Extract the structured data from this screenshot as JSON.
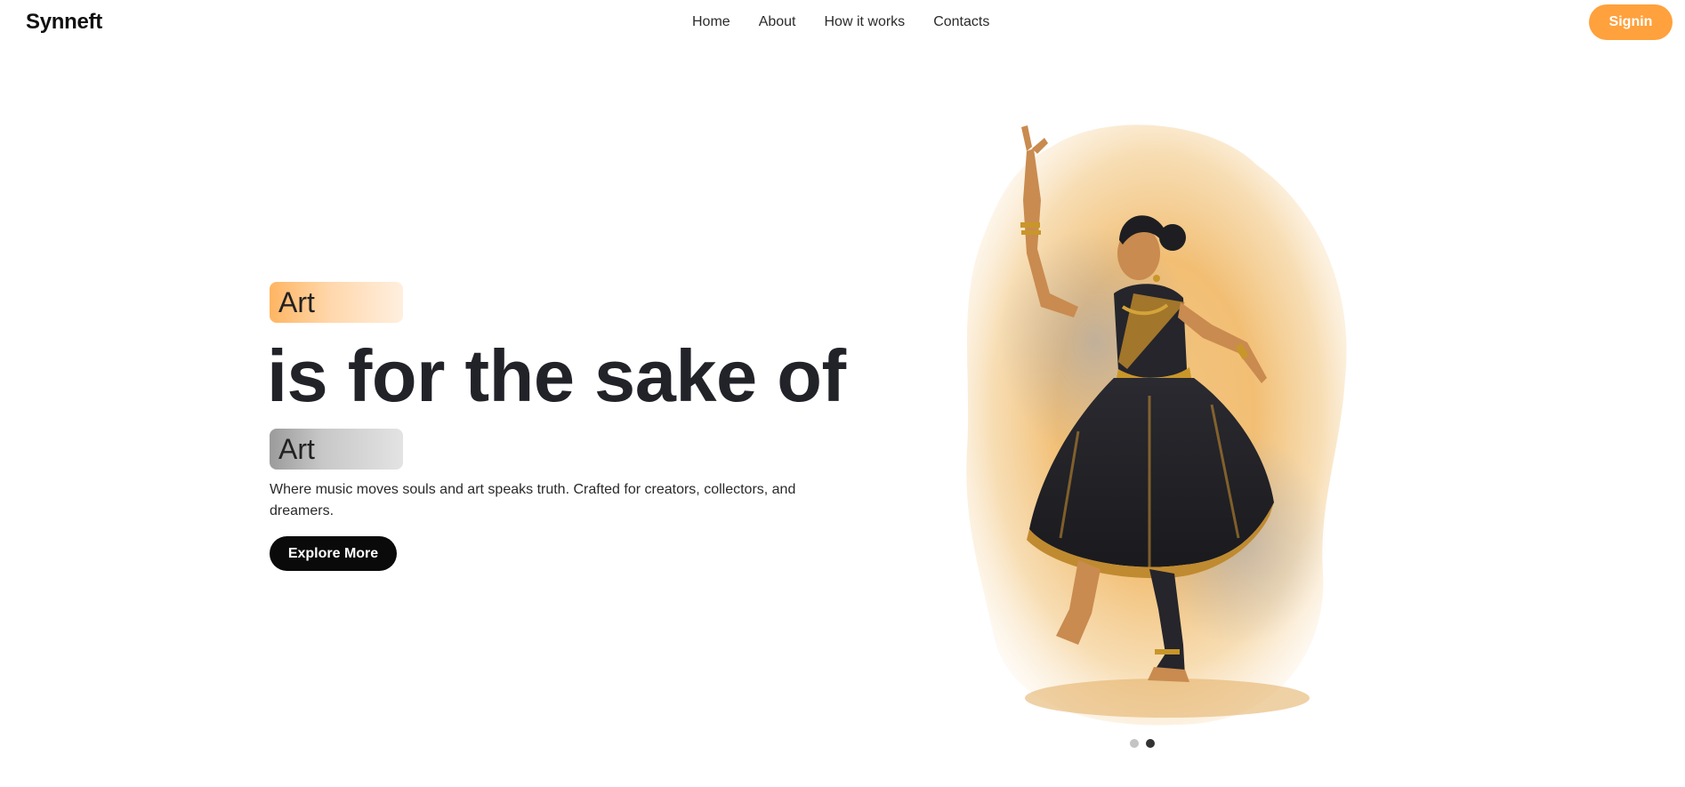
{
  "header": {
    "logo": "Synneft",
    "nav": [
      {
        "label": "Home"
      },
      {
        "label": "About"
      },
      {
        "label": "How it works"
      },
      {
        "label": "Contacts"
      }
    ],
    "signin_label": "Signin",
    "accent_color": "#ffa13c"
  },
  "hero": {
    "tag_top": "Art",
    "headline": "is for the sake of",
    "tag_bottom": "Art",
    "description": "Where music moves souls and art speaks truth. Crafted for creators, collectors, and dreamers.",
    "cta_label": "Explore More",
    "image_icon": "watercolor-dancer-illustration",
    "carousel": {
      "slides": 2,
      "active_slide": 2
    }
  }
}
